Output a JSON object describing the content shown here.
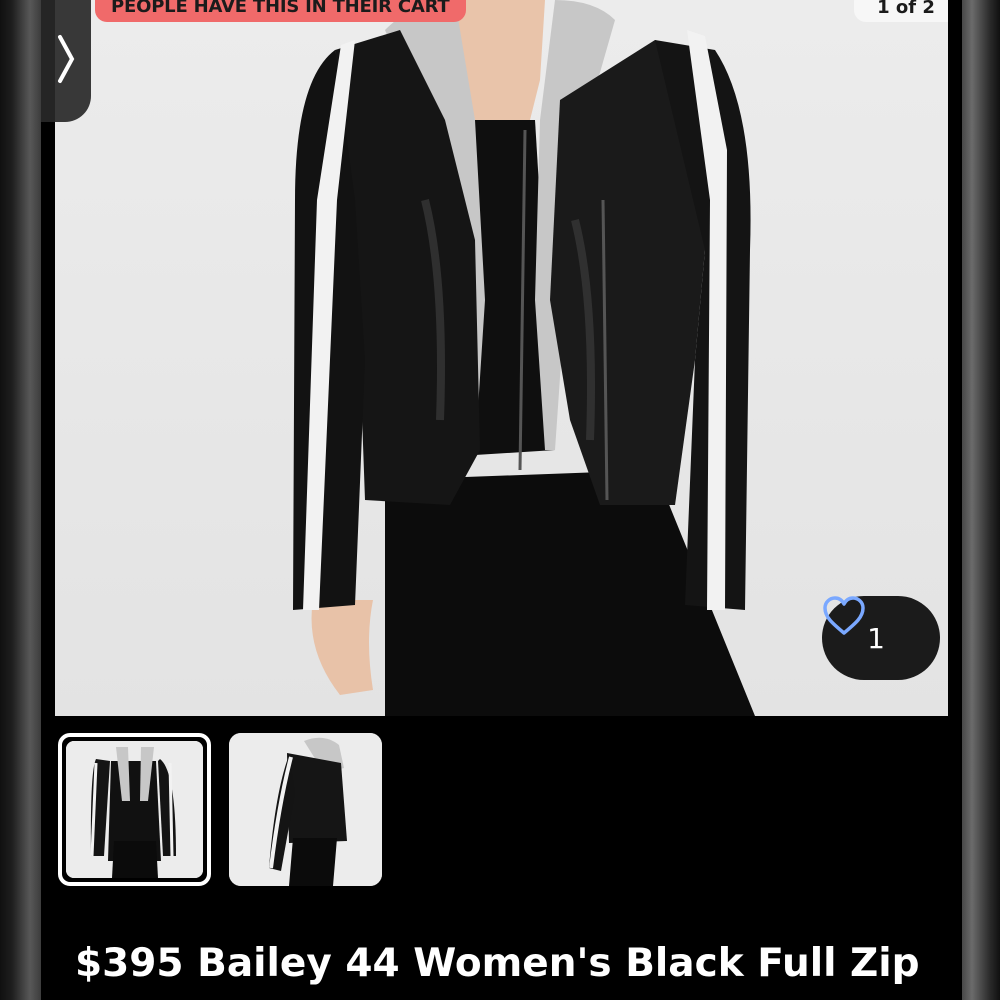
{
  "banner": {
    "cart_text": "PEOPLE HAVE THIS IN THEIR CART"
  },
  "carousel": {
    "indicator": "1 of 2",
    "prev_icon": "chevron-right-icon"
  },
  "like": {
    "count": "1",
    "icon": "heart-outline-icon"
  },
  "thumbnails": [
    {
      "label": "jacket-front-view",
      "selected": true
    },
    {
      "label": "jacket-side-view",
      "selected": false
    }
  ],
  "listing": {
    "title_line1": "$395 Bailey 44 Women's Black Full Zip"
  },
  "colors": {
    "badge": "#f06a6a",
    "heart": "#7aa8ff",
    "background": "#000000"
  }
}
